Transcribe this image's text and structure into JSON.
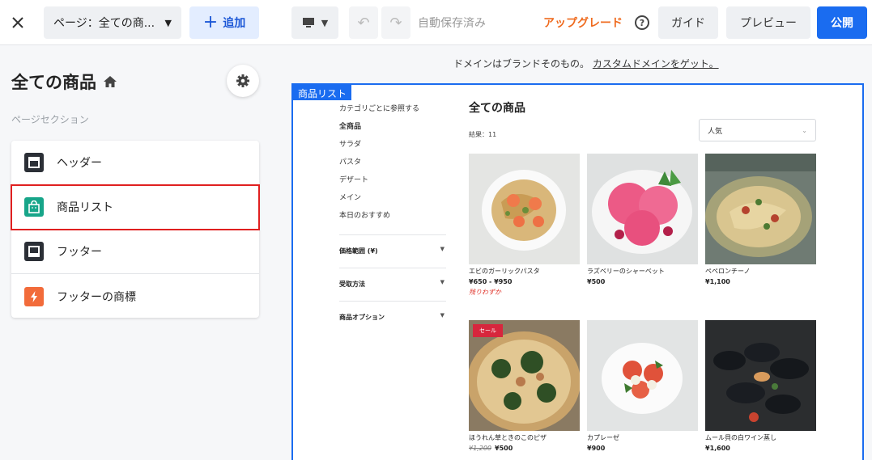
{
  "toolbar": {
    "page_selector": "ページ：全ての商...",
    "add_label": "追加",
    "autosave": "自動保存済み",
    "upgrade": "アップグレード",
    "guide": "ガイド",
    "preview": "プレビュー",
    "publish": "公開"
  },
  "sidebar": {
    "page_title": "全ての商品",
    "sections_label": "ページセクション",
    "sections": [
      {
        "label": "ヘッダー",
        "icon": "header-icon"
      },
      {
        "label": "商品リスト",
        "icon": "shop-bag-icon",
        "selected": true
      },
      {
        "label": "フッター",
        "icon": "footer-icon"
      },
      {
        "label": "フッターの商標",
        "icon": "lightning-icon"
      }
    ]
  },
  "domain_note": {
    "text": "ドメインはブランドそのもの。",
    "link": "カスタムドメインをゲット。"
  },
  "preview": {
    "tag": "商品リスト",
    "category_title": "カテゴリごとに参照する",
    "categories": [
      "全商品",
      "サラダ",
      "パスタ",
      "デザート",
      "メイン",
      "本日のおすすめ"
    ],
    "filters": [
      "価格範囲 (¥)",
      "受取方法",
      "商品オプション"
    ],
    "heading": "全ての商品",
    "results": "結果：11",
    "sort": "人気",
    "products": [
      {
        "name": "エビのガーリックパスタ",
        "price": "¥650 - ¥950",
        "stock": "残りわずか"
      },
      {
        "name": "ラズベリーのシャーベット",
        "price": "¥500"
      },
      {
        "name": "ペペロンチーノ",
        "price": "¥1,100"
      },
      {
        "name": "ほうれん草ときのこのピザ",
        "old_price": "¥1,200",
        "price": "¥500",
        "badge": "セール"
      },
      {
        "name": "カプレーゼ",
        "price": "¥900"
      },
      {
        "name": "ムール貝の白ワイン蒸し",
        "price": "¥1,600"
      }
    ]
  },
  "colors": {
    "accent": "#1a6cf0",
    "upgrade": "#ef6b1f",
    "selection": "#e02020",
    "sale": "#d7263d"
  }
}
